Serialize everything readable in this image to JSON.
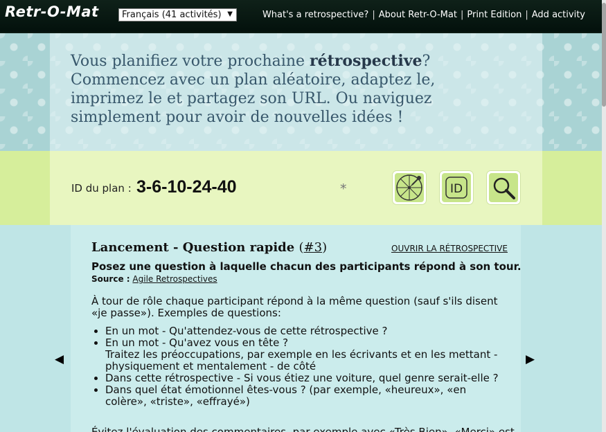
{
  "header": {
    "logo": "Retr-O-Mat",
    "language_select": "Français (41 activités)",
    "nav": [
      "What's a retrospective?",
      "About Retr-O-Mat",
      "Print Edition",
      "Add activity"
    ],
    "nav_separator": "|"
  },
  "hero": {
    "text_before": "Vous planifiez votre prochaine ",
    "text_bold": "rétrospective",
    "text_after": "? Commencez avec un plan aléatoire, adaptez le, imprimez le et partagez son URL. Ou naviguez simplement pour avoir de nouvelles idées !"
  },
  "plan": {
    "label": "ID du plan :",
    "id": "3-6-10-24-40",
    "star": "*",
    "buttons": {
      "random_icon": "wheel-icon",
      "id_icon": "id-icon",
      "search_icon": "search-icon",
      "id_text": "ID"
    }
  },
  "activity": {
    "title": "Lancement - Question rapide",
    "number_open": "(",
    "number": "#3",
    "number_close": ")",
    "open_link": "OUVRIR LA RÉTROSPECTIVE",
    "summary": "Posez une question à laquelle chacun des participants répond à son tour.",
    "source_label": "Source :",
    "source_link": "Agile Retrospectives",
    "intro": "À tour de rôle chaque participant répond à la même question (sauf s'ils disent «je passe»). Exemples de questions:",
    "bullets": [
      {
        "main": "En un mot - Qu'attendez-vous de cette rétrospective ?",
        "sub": ""
      },
      {
        "main": "En un mot - Qu'avez vous en tête ?",
        "sub": "Traitez les préoccupations, par exemple en les écrivants et en les mettant - physiquement et mentalement - de côté"
      },
      {
        "main": "Dans cette rétrospective - Si vous étiez une voiture, quel genre serait-elle ?",
        "sub": ""
      },
      {
        "main": "Dans quel état émotionnel êtes-vous ? (par exemple, «heureux», «en colère», «triste», «effrayé»)",
        "sub": ""
      }
    ],
    "footer_partial": "Évitez l'évaluation des commentaires, par exemple avec «Très Bien», «Merci» est"
  },
  "navigation": {
    "prev": "◀",
    "next": "▶"
  }
}
